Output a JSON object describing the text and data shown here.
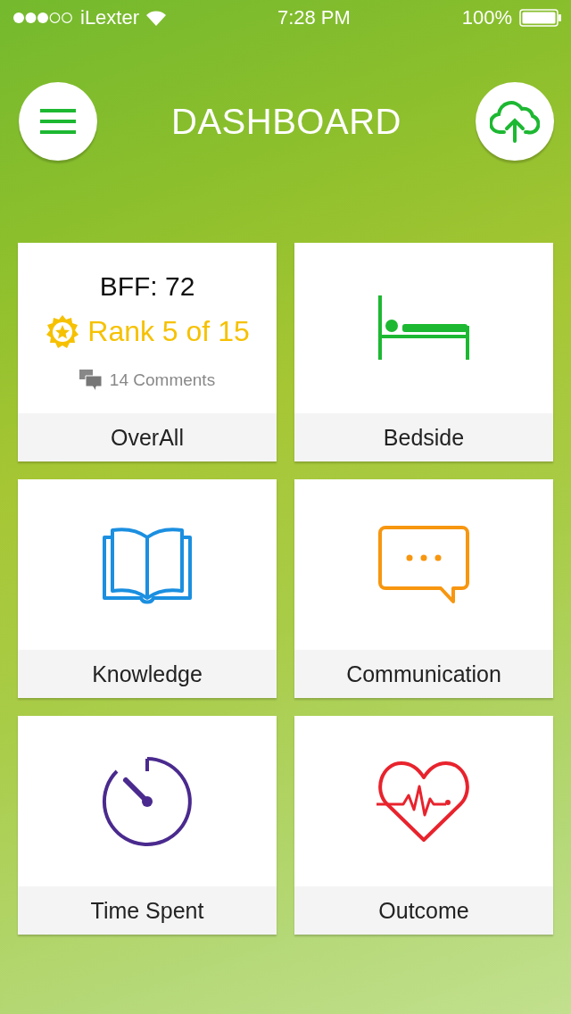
{
  "status_bar": {
    "carrier": "iLexter",
    "time": "7:28 PM",
    "battery": "100%"
  },
  "header": {
    "title": "DASHBOARD"
  },
  "tiles": [
    {
      "kind": "summary",
      "label": "OverAll",
      "score": "BFF: 72",
      "rank": "Rank 5 of 15",
      "comments": "14 Comments"
    },
    {
      "kind": "icon",
      "label": "Bedside",
      "color": "#1db832"
    },
    {
      "kind": "icon",
      "label": "Knowledge",
      "color": "#1b8fe0"
    },
    {
      "kind": "icon",
      "label": "Communication",
      "color": "#f7960f"
    },
    {
      "kind": "icon",
      "label": "Time Spent",
      "color": "#4a2a8e"
    },
    {
      "kind": "icon",
      "label": "Outcome",
      "color": "#e8232d"
    }
  ]
}
